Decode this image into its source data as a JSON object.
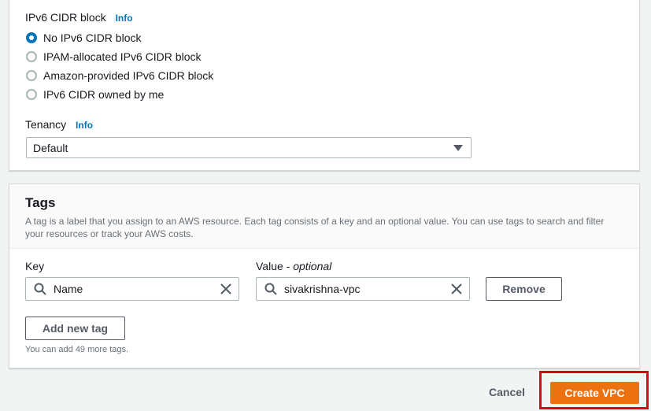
{
  "ipv6": {
    "label": "IPv6 CIDR block",
    "info": "Info",
    "options": [
      {
        "label": "No IPv6 CIDR block",
        "checked": true
      },
      {
        "label": "IPAM-allocated IPv6 CIDR block",
        "checked": false
      },
      {
        "label": "Amazon-provided IPv6 CIDR block",
        "checked": false
      },
      {
        "label": "IPv6 CIDR owned by me",
        "checked": false
      }
    ]
  },
  "tenancy": {
    "label": "Tenancy",
    "info": "Info",
    "value": "Default"
  },
  "tags": {
    "title": "Tags",
    "description": "A tag is a label that you assign to an AWS resource. Each tag consists of a key and an optional value. You can use tags to search and filter your resources or track your AWS costs.",
    "key_label": "Key",
    "value_label": "Value",
    "value_optional": "optional",
    "rows": [
      {
        "key": "Name",
        "value": "sivakrishna-vpc"
      }
    ],
    "remove_label": "Remove",
    "add_label": "Add new tag",
    "hint": "You can add 49 more tags."
  },
  "footer": {
    "cancel_label": "Cancel",
    "create_label": "Create VPC"
  },
  "colors": {
    "accent": "#0073bb",
    "primary_button": "#ec7211",
    "highlight_box": "#e00012"
  },
  "icons": [
    "search-icon",
    "clear-icon",
    "caret-down-icon"
  ]
}
